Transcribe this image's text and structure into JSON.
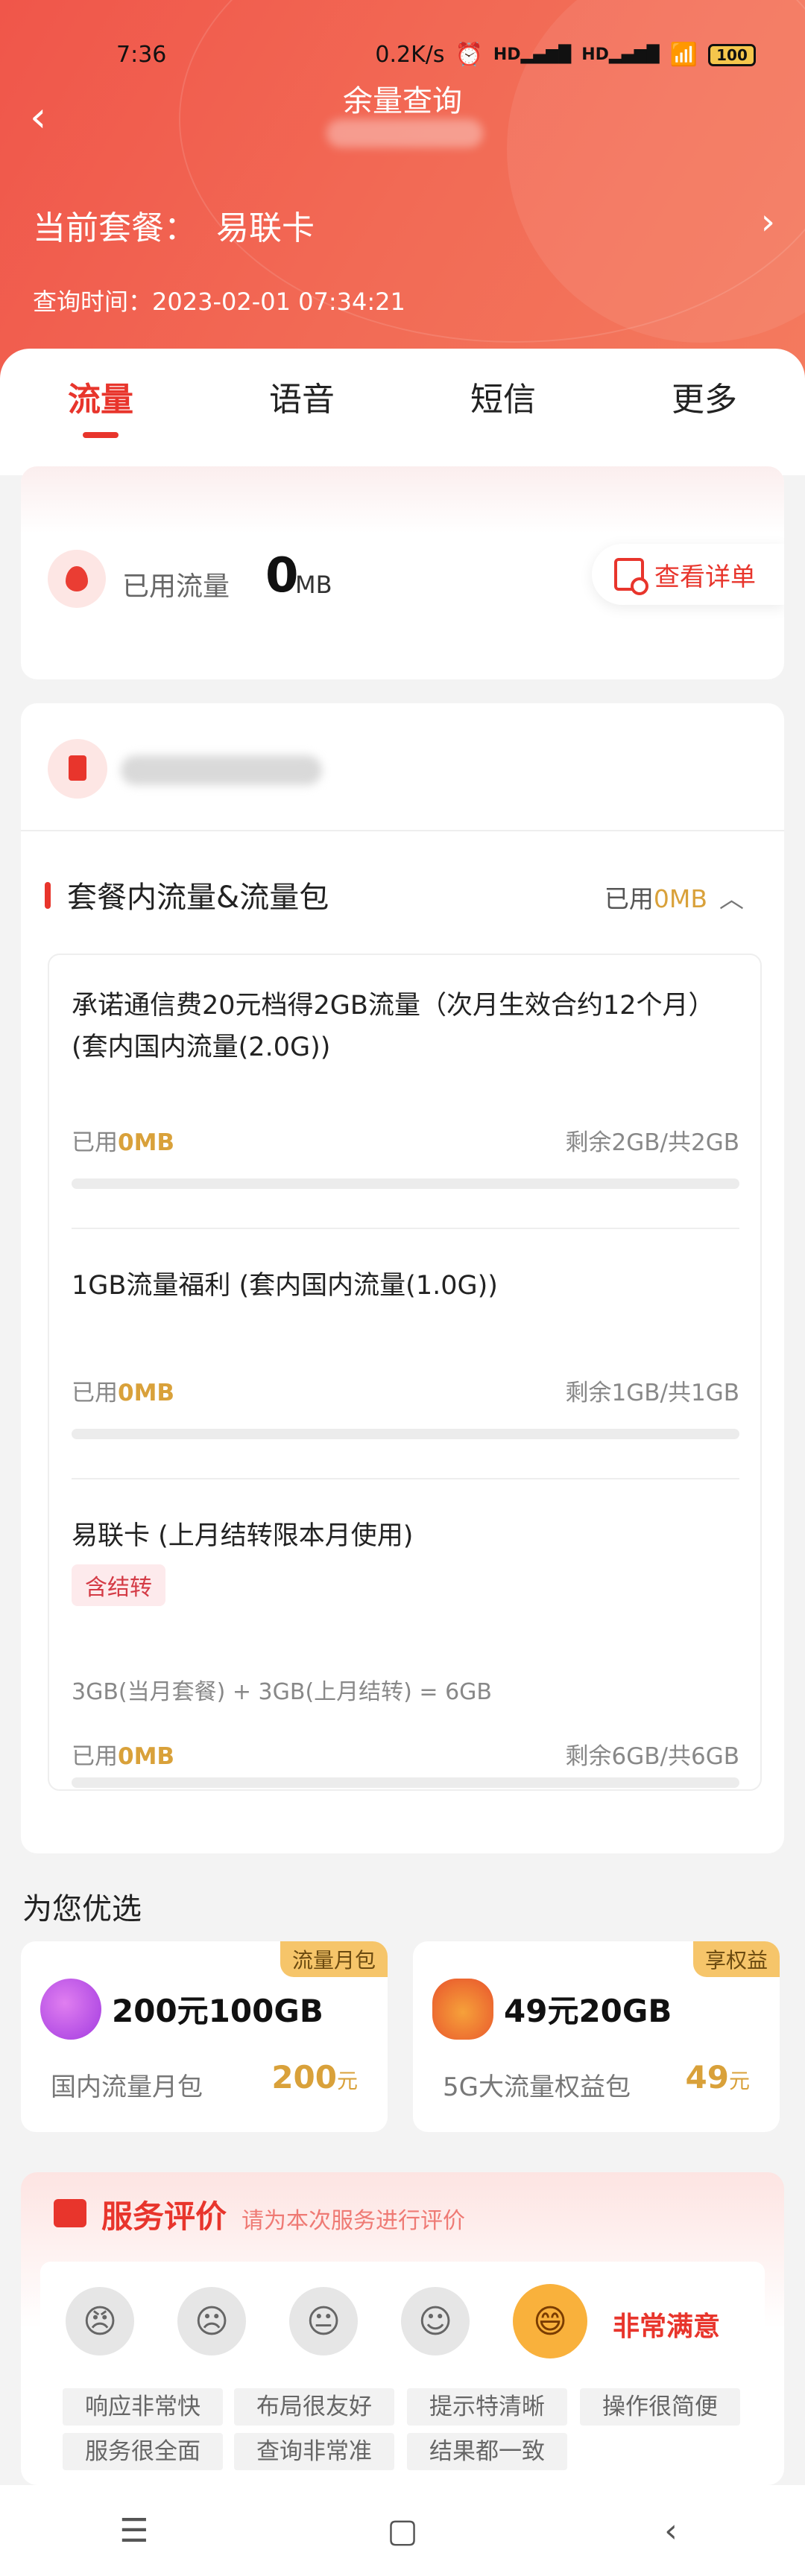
{
  "status_bar": {
    "time": "7:36",
    "speed": "0.2K/s",
    "signal1": "HD",
    "signal2": "HD",
    "battery": "100"
  },
  "header": {
    "title": "余量查询",
    "plan_label": "当前套餐：",
    "plan_name": "易联卡",
    "query_time": "查询时间：2023-02-01 07:34:21"
  },
  "tabs": [
    {
      "label": "流量",
      "active": true
    },
    {
      "label": "语音",
      "active": false
    },
    {
      "label": "短信",
      "active": false
    },
    {
      "label": "更多",
      "active": false
    }
  ],
  "usage": {
    "label": "已用流量",
    "value": "0",
    "unit": "MB",
    "detail_button": "查看详单"
  },
  "package": {
    "section_title": "套餐内流量&流量包",
    "used_prefix": "已用",
    "used_value": "0MB",
    "items": [
      {
        "title": "承诺通信费20元档得2GB流量（次月生效合约12个月）(套内国内流量(2.0G))",
        "used_prefix": "已用",
        "used_value": "0MB",
        "remain": "剩余2GB/共2GB",
        "used_fraction": 0
      },
      {
        "title": "1GB流量福利 (套内国内流量(1.0G))",
        "used_prefix": "已用",
        "used_value": "0MB",
        "remain": "剩余1GB/共1GB",
        "used_fraction": 0
      },
      {
        "title": "易联卡 (上月结转限本月使用)",
        "tag": "含结转",
        "note": "3GB(当月套餐) + 3GB(上月结转) = 6GB",
        "used_prefix": "已用",
        "used_value": "0MB",
        "remain": "剩余6GB/共6GB",
        "used_fraction": 0
      }
    ]
  },
  "recommend": {
    "title": "为您优选",
    "cards": [
      {
        "badge": "流量月包",
        "name": "200元100GB",
        "sub": "国内流量月包",
        "price": "200",
        "price_unit": "元",
        "icon": "rocket-icon"
      },
      {
        "badge": "享权益",
        "name": "49元20GB",
        "sub": "5G大流量权益包",
        "price": "49",
        "price_unit": "元",
        "icon": "crown-medal-icon"
      }
    ]
  },
  "evaluation": {
    "title": "服务评价",
    "subtitle": "请为本次服务进行评价",
    "selected": "非常满意",
    "faces": [
      "😠",
      "☹",
      "😐",
      "☺",
      "😄"
    ],
    "chips": [
      "响应非常快",
      "布局很友好",
      "提示特清晰",
      "操作很简便",
      "服务很全面",
      "查询非常准",
      "结果都一致"
    ]
  },
  "colors": {
    "accent": "#e8352c",
    "gold": "#d9a13a"
  }
}
